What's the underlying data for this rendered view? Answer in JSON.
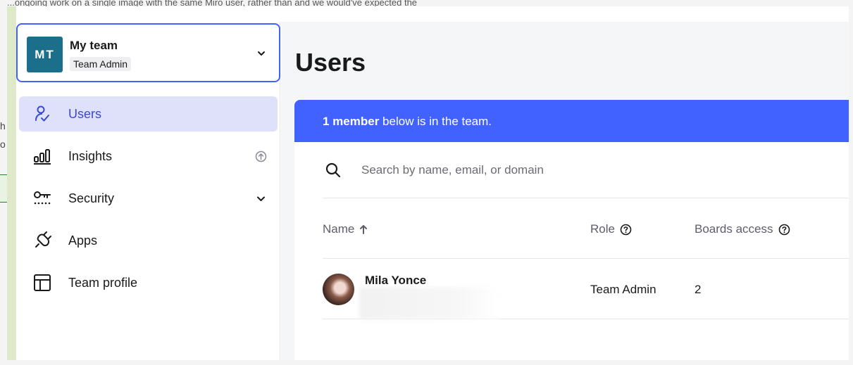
{
  "background": {
    "top_text": "...ongoing work on a single image with the same Miro user, rather than and we would've expected the",
    "fragment_1": "h",
    "fragment_2": "o"
  },
  "team": {
    "avatar_initials": "MT",
    "name": "My team",
    "role_badge": "Team Admin"
  },
  "sidebar": {
    "items": [
      {
        "label": "Users",
        "icon": "user-check-icon",
        "active": true
      },
      {
        "label": "Insights",
        "icon": "bar-chart-icon",
        "active": false,
        "right_icon": "upgrade-icon"
      },
      {
        "label": "Security",
        "icon": "key-icon",
        "active": false,
        "right_icon": "chevron-down-icon"
      },
      {
        "label": "Apps",
        "icon": "plug-icon",
        "active": false
      },
      {
        "label": "Team profile",
        "icon": "layout-icon",
        "active": false
      }
    ]
  },
  "main": {
    "title": "Users",
    "banner": {
      "bold": "1 member",
      "rest": " below is in the team."
    },
    "search": {
      "placeholder": "Search by name, email, or domain",
      "value": ""
    },
    "table": {
      "headers": {
        "name": "Name",
        "role": "Role",
        "boards_access": "Boards access"
      },
      "rows": [
        {
          "name": "Mila Yonce",
          "role": "Team Admin",
          "boards_access": "2"
        }
      ]
    }
  },
  "colors": {
    "accent": "#4262ff",
    "active_nav_bg": "#dfe1fb",
    "team_avatar": "#1b6f8a"
  }
}
